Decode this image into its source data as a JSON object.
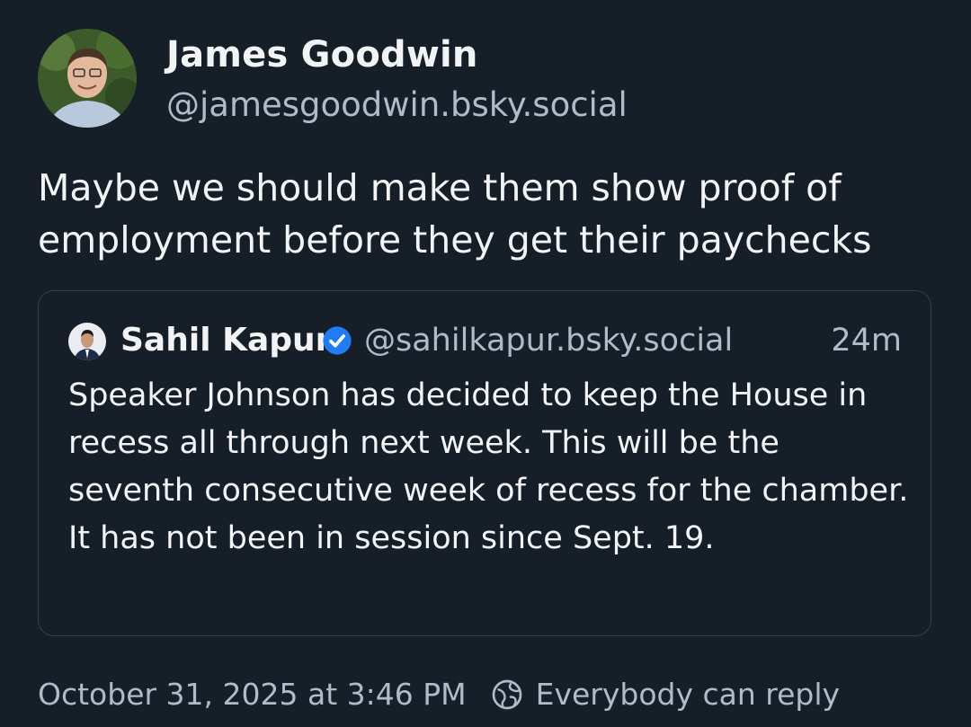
{
  "post": {
    "author": {
      "name": "James Goodwin",
      "handle": "@jamesgoodwin.bsky.social"
    },
    "text": "Maybe we should make them show proof of employment before they get their paychecks"
  },
  "quote": {
    "author": {
      "name": "Sahil Kapur",
      "handle": "@sahilkapur.bsky.social",
      "verified": true
    },
    "time": "24m",
    "text": "Speaker Johnson has decided to keep the House in recess all through next week. This will be the seventh consecutive week of recess for the chamber. It has not been in session since Sept. 19."
  },
  "footer": {
    "timestamp": "October 31, 2025 at 3:46 PM",
    "reply_setting": "Everybody can reply"
  },
  "colors": {
    "background": "#161e27",
    "text_primary": "#f1f3f5",
    "text_secondary": "#aebbc9",
    "border": "#2e4052",
    "verified": "#1f7cf5"
  },
  "icons": {
    "verified": "verified-check-icon",
    "reply_setting": "globe-icon"
  }
}
